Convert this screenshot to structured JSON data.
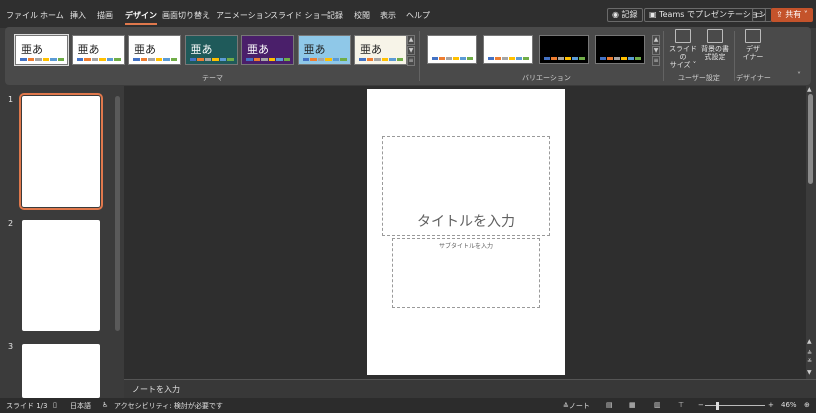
{
  "menu": {
    "tabs": [
      "ファイル",
      "ホーム",
      "挿入",
      "描画",
      "デザイン",
      "画面切り替え",
      "アニメーション",
      "スライド ショー",
      "記録",
      "校閲",
      "表示",
      "ヘルプ"
    ],
    "active_tab": "デザイン",
    "record_button": "記録",
    "teams_button": "Teams でプレゼンテーション",
    "share_button": "共有"
  },
  "ribbon": {
    "themes": [
      {
        "label": "亜あ",
        "bg": "#ffffff",
        "fg": "#222222"
      },
      {
        "label": "亜あ",
        "bg": "#ffffff",
        "fg": "#222222"
      },
      {
        "label": "亜あ",
        "bg": "#ffffff",
        "fg": "#222222"
      },
      {
        "label": "亜あ",
        "bg": "#1f5a5a",
        "fg": "#ffffff"
      },
      {
        "label": "亜あ",
        "bg": "#4a1f6a",
        "fg": "#ffffff"
      },
      {
        "label": "亜あ",
        "bg": "#8fc8e8",
        "fg": "#222222"
      },
      {
        "label": "亜あ",
        "bg": "#f7f4e8",
        "fg": "#222222"
      }
    ],
    "theme_group_label": "テーマ",
    "variants": [
      {
        "bg": "#ffffff"
      },
      {
        "bg": "#ffffff"
      },
      {
        "bg": "#000000"
      },
      {
        "bg": "#000000"
      }
    ],
    "variation_group_label": "バリエーション",
    "slide_size_label_1": "スライドの",
    "slide_size_label_2": "サイズ ˅",
    "bg_format_label_1": "背景の書",
    "bg_format_label_2": "式設定",
    "user_group_label": "ユーザー設定",
    "designer_label_1": "デザ",
    "designer_label_2": "イナー",
    "designer_group_label": "デザイナー"
  },
  "thumbnails": [
    {
      "number": "1"
    },
    {
      "number": "2"
    },
    {
      "number": "3"
    }
  ],
  "slide": {
    "title_placeholder": "タイトルを入力",
    "subtitle_placeholder": "サブタイトルを入力"
  },
  "notes": {
    "placeholder": "ノートを入力"
  },
  "status": {
    "slide_counter": "スライド 1/3",
    "language": "日本語",
    "accessibility": "アクセシビリティ: 検討が必要です",
    "notes_button": "ノート",
    "zoom_minus": "−",
    "zoom_plus": "+",
    "zoom": "46%"
  },
  "colors": {
    "accent": "#e0784c",
    "share_bg": "#c4532b"
  }
}
